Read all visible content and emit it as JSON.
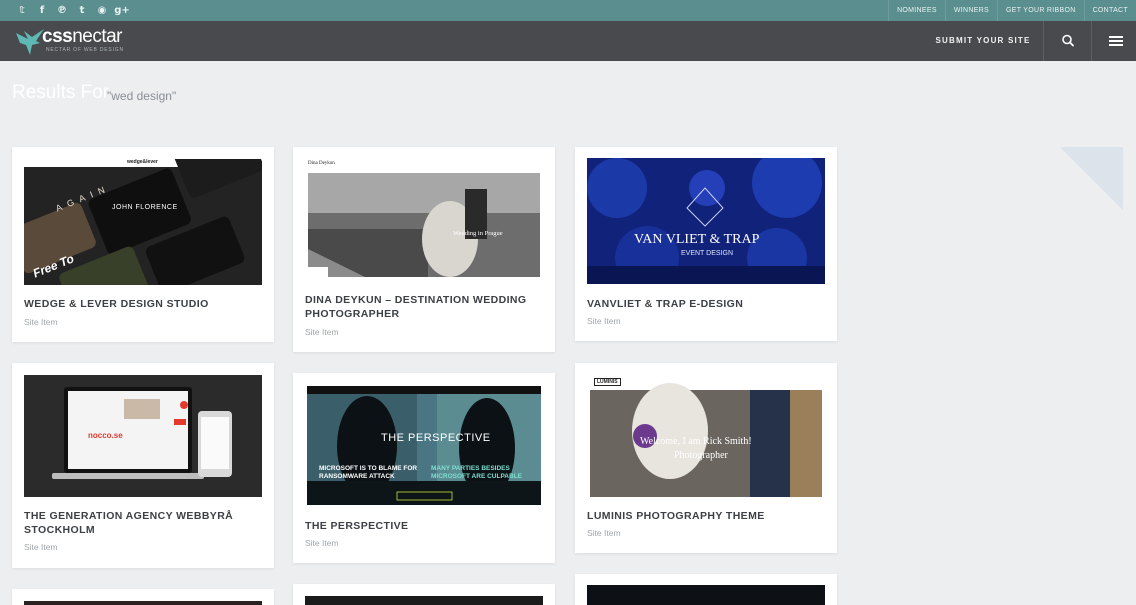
{
  "social": {
    "icons": [
      "twitter-icon",
      "facebook-icon",
      "pinterest-icon",
      "tumblr-icon",
      "rss-icon",
      "google-plus-icon"
    ],
    "glyphs": [
      "𝕥",
      "f",
      "℗",
      "t",
      "◉",
      "g+"
    ]
  },
  "top_nav": [
    "NOMINEES",
    "WINNERS",
    "GET YOUR RIBBON",
    "CONTACT"
  ],
  "header": {
    "logo_bold": "css",
    "logo_light": "nectar",
    "logo_tagline": "NECTAR OF WEB DESIGN",
    "submit_label": "SUBMIT YOUR SITE"
  },
  "results": {
    "label": "Results For",
    "query": "\"wed design\""
  },
  "colors": {
    "topbar": "#5b8e8e",
    "header": "#484a4d",
    "background": "#eceef0",
    "accent": "#5fb8b3"
  },
  "cards": [
    {
      "title": "WEDGE & LEVER DESIGN STUDIO",
      "sub": "Site Item",
      "thumb": {
        "brand": "wedge&lever",
        "headline": "JOHN FLORENCE",
        "word1": "AGAIN",
        "word2": "Free To"
      }
    },
    {
      "title": "DINA DEYKUN – DESTINATION WEDDING PHOTOGRAPHER",
      "sub": "Site Item",
      "thumb": {
        "brand": "Dina Deykun",
        "caption": "Wedding in Prague"
      }
    },
    {
      "title": "VANVLIET & TRAP E-DESIGN",
      "sub": "Site Item",
      "thumb": {
        "headline": "VAN VLIET & TRAP",
        "tagline": "EVENT DESIGN"
      }
    },
    {
      "title": "THE GENERATION AGENCY WEBBYRÅ STOCKHOLM",
      "sub": "Site Item",
      "thumb": {
        "brand": "nocco.se"
      }
    },
    {
      "title": "THE PERSPECTIVE",
      "sub": "Site Item",
      "thumb": {
        "logo": "THE PERSPECTIVE",
        "left_text": "MICROSOFT IS TO BLAME FOR RANSOMWARE ATTACK",
        "right_text": "MANY PARTIES BESIDES MICROSOFT ARE CULPABLE"
      }
    },
    {
      "title": "LUMINIS PHOTOGRAPHY THEME",
      "sub": "Site Item",
      "thumb": {
        "brand": "LUMINIS",
        "headline": "Welcome, I am Rick Smith!",
        "subline": "Photographer"
      }
    }
  ]
}
